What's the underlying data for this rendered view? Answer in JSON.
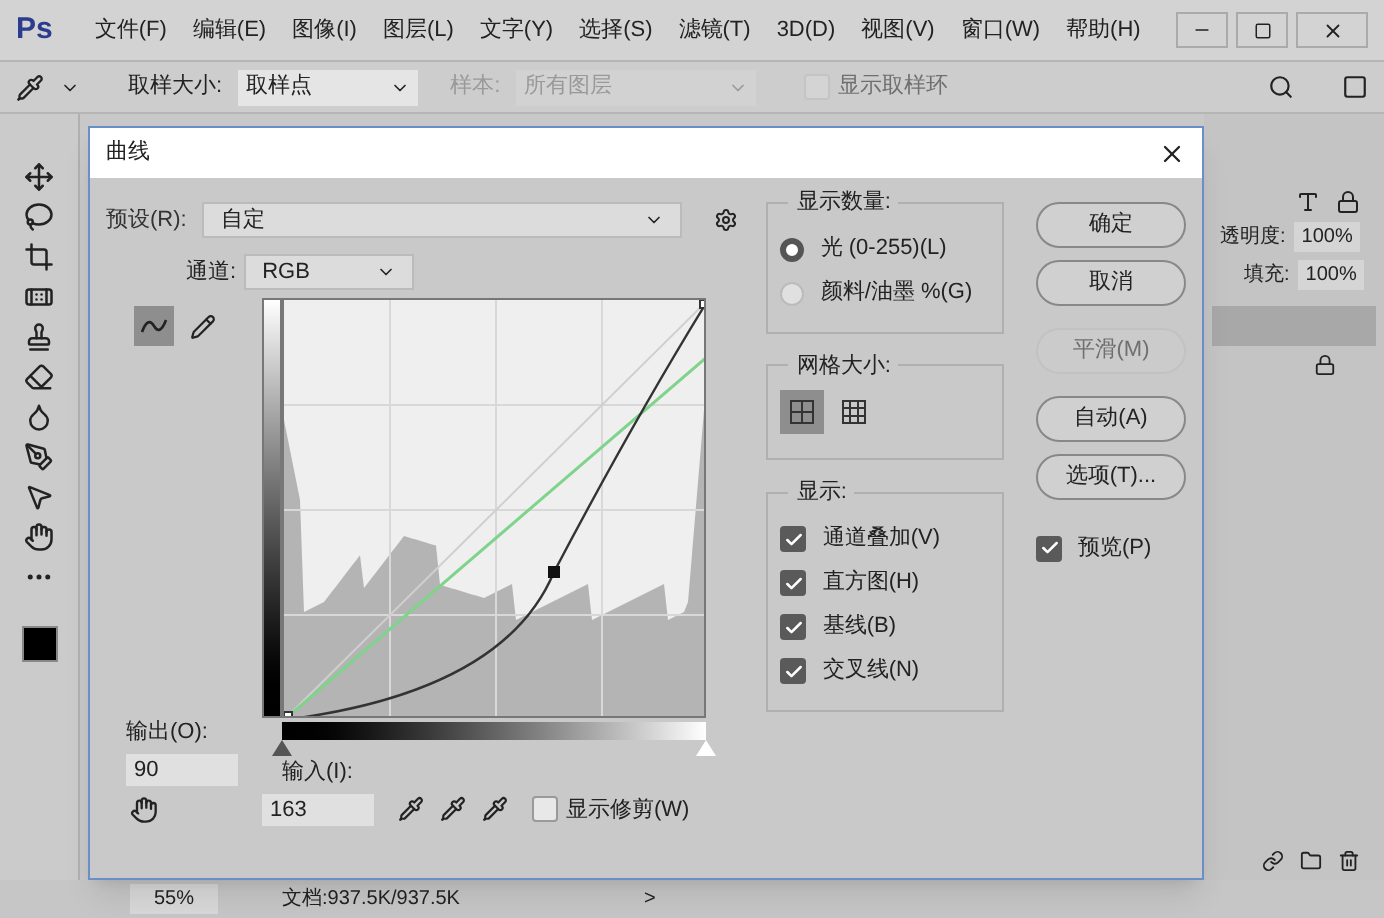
{
  "app": {
    "logo": "Ps",
    "menu": [
      "文件(F)",
      "编辑(E)",
      "图像(I)",
      "图层(L)",
      "文字(Y)",
      "选择(S)",
      "滤镜(T)",
      "3D(D)",
      "视图(V)",
      "窗口(W)",
      "帮助(H)"
    ]
  },
  "options_bar": {
    "sample_size_label": "取样大小:",
    "sample_size_value": "取样点",
    "sample_label": "样本:",
    "sample_value": "所有图层",
    "show_ring": {
      "label": "显示取样环",
      "checked": false,
      "disabled": true
    }
  },
  "dialog": {
    "title": "曲线",
    "preset": {
      "label": "预设(R):",
      "value": "自定"
    },
    "channel": {
      "label": "通道:",
      "value": "RGB"
    },
    "curve_tools": [
      {
        "kind": "curve",
        "selected": true
      },
      {
        "kind": "pencil",
        "selected": false
      }
    ],
    "input_sliders": [
      {
        "kind": "shadow",
        "level": 0
      },
      {
        "kind": "highlight",
        "level": 1
      }
    ],
    "output": {
      "label": "输出(O):",
      "value": "90"
    },
    "input": {
      "label": "输入(I):",
      "value": "163"
    },
    "show_clipping": {
      "label": "显示修剪(W)",
      "checked": false
    },
    "display_amount": {
      "title": "显示数量:",
      "options": [
        {
          "label": "光 (0-255)(L)",
          "selected": true
        },
        {
          "label": "颜料/油墨 %(G)",
          "selected": false
        }
      ]
    },
    "grid_size": {
      "title": "网格大小:",
      "options": [
        {
          "kind": "coarse",
          "selected": true
        },
        {
          "kind": "fine",
          "selected": false
        }
      ]
    },
    "show": {
      "title": "显示:",
      "options": [
        {
          "label": "通道叠加(V)",
          "checked": true
        },
        {
          "label": "直方图(H)",
          "checked": true
        },
        {
          "label": "基线(B)",
          "checked": true
        },
        {
          "label": "交叉线(N)",
          "checked": true
        }
      ]
    },
    "buttons": [
      {
        "label": "确定",
        "disabled": false
      },
      {
        "label": "取消",
        "disabled": false
      },
      {
        "label": "平滑(M)",
        "disabled": true
      },
      {
        "label": "自动(A)",
        "disabled": false
      },
      {
        "label": "选项(T)...",
        "disabled": false
      }
    ],
    "preview": {
      "label": "预览(P)",
      "checked": true
    }
  },
  "right_panel": {
    "opacity": {
      "label": "透明度:",
      "value": "100%"
    },
    "fill": {
      "label": "填充:",
      "value": "100%"
    }
  },
  "status_bar": {
    "zoom": "55%",
    "doc": "文档:937.5K/937.5K",
    "arrow": ">"
  }
}
